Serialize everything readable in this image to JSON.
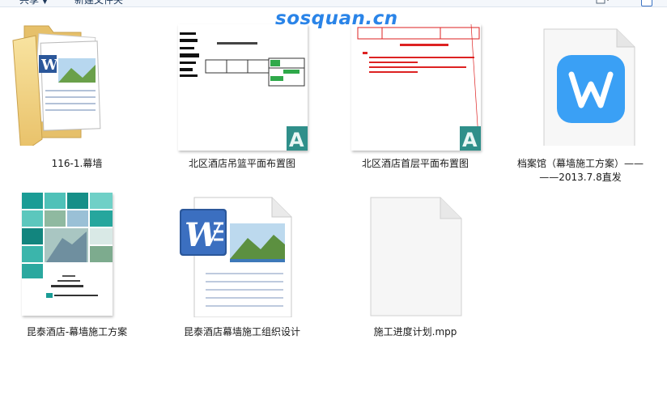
{
  "toolbar": {
    "share_label": "共享",
    "new_folder_label": "新建文件夹"
  },
  "watermark": "sosquan.cn",
  "files": [
    {
      "name": "116-1.幕墙",
      "icon": "folder-word-icon"
    },
    {
      "name": "北区酒店吊篮平面布置图",
      "icon": "autocad-thumbnail"
    },
    {
      "name": "北区酒店首层平面布置图",
      "icon": "autocad-thumbnail"
    },
    {
      "name": "档案馆（幕墙施工方案）——",
      "name_line2": "——2013.7.8直发",
      "icon": "wps-writer-icon"
    },
    {
      "name": "昆泰酒店-幕墙施工方案",
      "icon": "document-cover-thumbnail"
    },
    {
      "name": "昆泰酒店幕墙施工组织设计",
      "icon": "word-document-icon"
    },
    {
      "name": "施工进度计划.mpp",
      "icon": "blank-file-icon"
    }
  ],
  "colors": {
    "wps_blue": "#3aa0f5",
    "word_blue": "#2b579a",
    "cad_teal": "#2f8f8a",
    "folder_yellow": "#f2d27a",
    "watermark_blue": "#2a84e8"
  }
}
